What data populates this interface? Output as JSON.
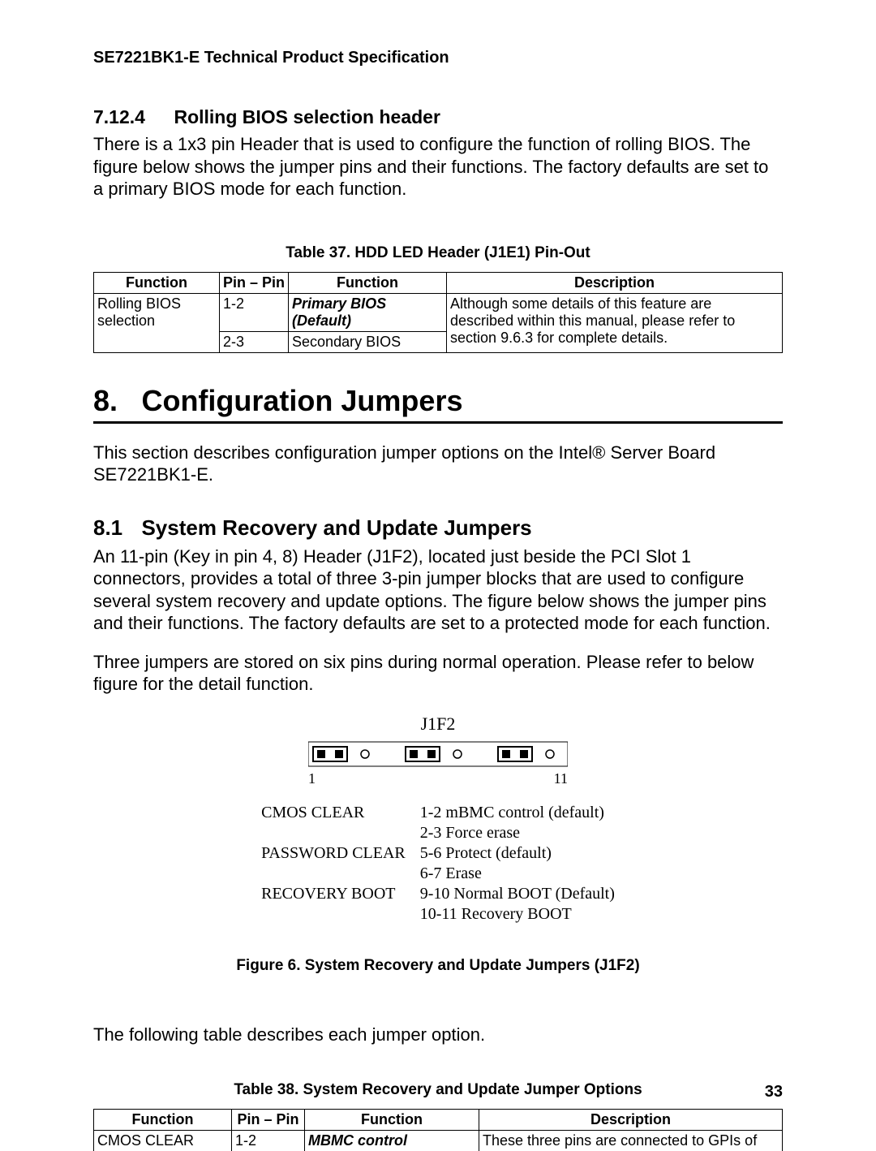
{
  "running_header": "SE7221BK1-E Technical Product Specification",
  "sec_7_12_4": {
    "num": "7.12.4",
    "title": "Rolling BIOS selection header",
    "body": "There is a 1x3 pin Header that is used to configure the function of rolling BIOS. The figure below shows the jumper pins and their functions. The factory defaults are set to a primary BIOS mode for each function."
  },
  "table37": {
    "caption": "Table 37.  HDD LED Header (J1E1) Pin-Out",
    "headers": [
      "Function",
      "Pin – Pin",
      "Function",
      "Description"
    ],
    "rows": [
      {
        "func_col1": "Rolling BIOS selection",
        "pin": "1-2",
        "func_col3": "Primary BIOS (Default)",
        "func_col3_style": "bi"
      },
      {
        "func_col1": "",
        "pin": "2-3",
        "func_col3": "Secondary BIOS",
        "func_col3_style": ""
      }
    ],
    "description_merged": "Although some details of this feature are described within this manual, please refer to section 9.6.3 for complete details."
  },
  "chapter8": {
    "num": "8.",
    "title": "Configuration Jumpers",
    "intro": "This section describes configuration jumper options on the Intel® Server Board SE7221BK1-E."
  },
  "sec_8_1": {
    "num": "8.1",
    "title": "System Recovery and Update Jumpers",
    "p1": "An 11-pin (Key in pin 4, 8) Header (J1F2), located just beside the PCI Slot 1 connectors, provides a total of three 3-pin jumper blocks that are used to configure several system recovery and update options. The figure below shows the jumper pins and their functions. The factory defaults are set to a protected mode for each function.",
    "p2": "Three jumpers are stored on six pins during normal operation. Please refer to below figure for the detail function."
  },
  "figure6": {
    "header_label": "J1F2",
    "pin_left_label": "1",
    "pin_right_label": "11",
    "legend": [
      {
        "name": "CMOS CLEAR",
        "a": "1-2 mBMC control (default)",
        "b": "2-3 Force erase"
      },
      {
        "name": "PASSWORD CLEAR",
        "a": "5-6 Protect (default)",
        "b": "6-7 Erase"
      },
      {
        "name": "RECOVERY BOOT",
        "a": "9-10 Normal BOOT (Default)",
        "b": "10-11 Recovery BOOT"
      }
    ],
    "caption": "Figure 6.  System Recovery and Update Jumpers (J1F2)"
  },
  "follow_text": "The following table describes each jumper option.",
  "table38": {
    "caption": "Table 38.  System Recovery and Update Jumper Options",
    "headers": [
      "Function",
      "Pin – Pin",
      "Function",
      "Description"
    ],
    "rows": [
      {
        "func_col1": "CMOS CLEAR",
        "pin": "1-2",
        "func_col3": "MBMC control",
        "func_col3_style": "bi",
        "desc": "These three pins are connected to GPIs of"
      }
    ]
  },
  "page_number": "33"
}
